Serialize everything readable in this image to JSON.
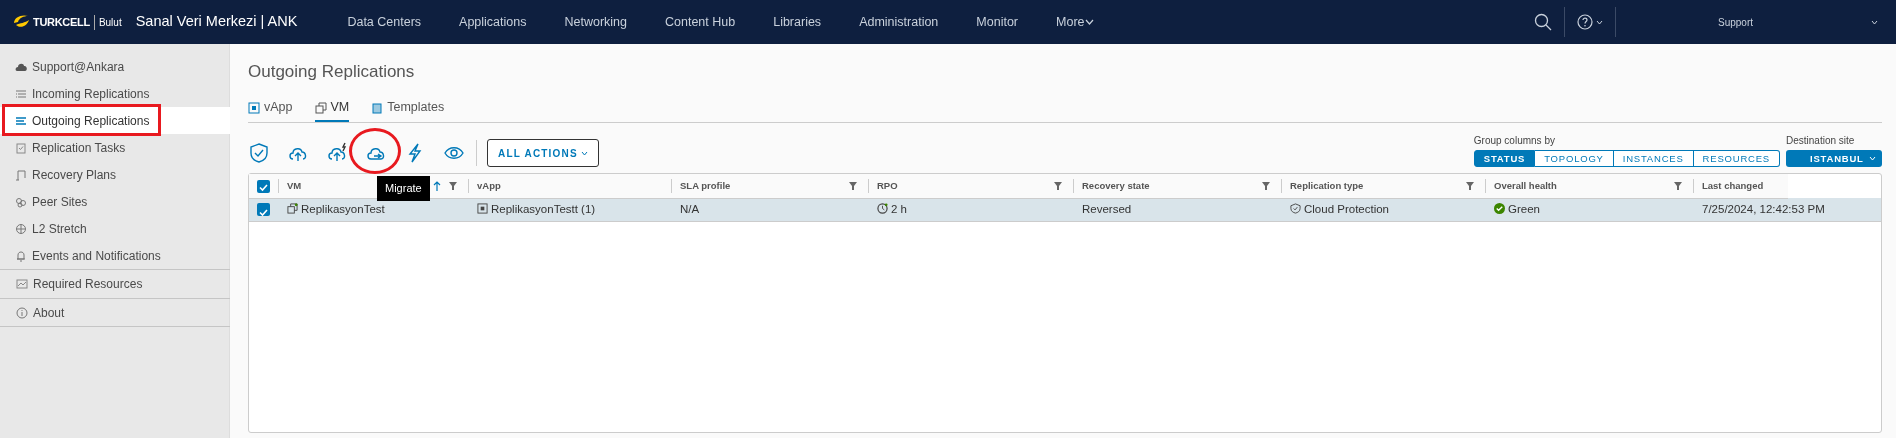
{
  "header": {
    "brand": "TURKCELL",
    "brand_sub": "Bulut",
    "title": "Sanal Veri Merkezi | ANK",
    "nav": [
      {
        "label": "Data Centers"
      },
      {
        "label": "Applications"
      },
      {
        "label": "Networking"
      },
      {
        "label": "Content Hub"
      },
      {
        "label": "Libraries"
      },
      {
        "label": "Administration"
      },
      {
        "label": "Monitor"
      },
      {
        "label": "More"
      }
    ],
    "user": "Support"
  },
  "sidebar": {
    "items": [
      {
        "label": "Support@Ankara",
        "kind": "link",
        "selected": false,
        "highlighted": false
      },
      {
        "label": "Incoming Replications",
        "kind": "link",
        "selected": false,
        "highlighted": false
      },
      {
        "label": "Outgoing Replications",
        "kind": "link",
        "selected": true,
        "highlighted": true
      },
      {
        "label": "Replication Tasks",
        "kind": "link",
        "selected": false,
        "highlighted": false
      },
      {
        "label": "Recovery Plans",
        "kind": "link",
        "selected": false,
        "highlighted": false
      },
      {
        "label": "Peer Sites",
        "kind": "link",
        "selected": false,
        "highlighted": false
      },
      {
        "label": "L2 Stretch",
        "kind": "link",
        "selected": false,
        "highlighted": false
      },
      {
        "label": "Events and Notifications",
        "kind": "link",
        "selected": false,
        "highlighted": false
      },
      {
        "label": "Required Resources",
        "kind": "section",
        "selected": false,
        "highlighted": false
      },
      {
        "label": "About",
        "kind": "section",
        "selected": false,
        "highlighted": false
      }
    ]
  },
  "page": {
    "title": "Outgoing Replications",
    "tabs": [
      {
        "label": "vApp",
        "selected": false
      },
      {
        "label": "VM",
        "selected": true
      },
      {
        "label": "Templates",
        "selected": false
      }
    ],
    "toolbar": {
      "actions": [
        {
          "kind": "protect"
        },
        {
          "kind": "upload"
        },
        {
          "kind": "upload-fast"
        },
        {
          "kind": "migrate",
          "highlighted": true,
          "tooltip": "Migrate"
        },
        {
          "kind": "failover"
        },
        {
          "kind": "view"
        }
      ],
      "all_actions": "ALL ACTIONS",
      "group_label": "Group columns by",
      "group_options": [
        {
          "label": "STATUS",
          "selected": true
        },
        {
          "label": "TOPOLOGY",
          "selected": false
        },
        {
          "label": "INSTANCES",
          "selected": false
        },
        {
          "label": "RESOURCES",
          "selected": false
        }
      ],
      "destination_label": "Destination site",
      "destination": "ISTANBUL"
    },
    "table": {
      "all_checked": true,
      "columns": [
        {
          "label": "VM",
          "sorted": true,
          "filter": true
        },
        {
          "label": "vApp",
          "sorted": false,
          "filter": false
        },
        {
          "label": "SLA profile",
          "sorted": false,
          "filter": true
        },
        {
          "label": "RPO",
          "sorted": false,
          "filter": true
        },
        {
          "label": "Recovery state",
          "sorted": false,
          "filter": true
        },
        {
          "label": "Replication type",
          "sorted": false,
          "filter": true
        },
        {
          "label": "Overall health",
          "sorted": false,
          "filter": true
        },
        {
          "label": "Last changed",
          "sorted": false,
          "filter": false
        }
      ],
      "rows": [
        {
          "selected": true,
          "vm": "ReplikasyonTest",
          "vapp": "ReplikasyonTestt (1)",
          "sla": "N/A",
          "rpo": "2 h",
          "recovery_state": "Reversed",
          "replication_type": "Cloud Protection",
          "health": "Green",
          "last_changed": "7/25/2024, 12:42:53 PM"
        }
      ]
    }
  }
}
